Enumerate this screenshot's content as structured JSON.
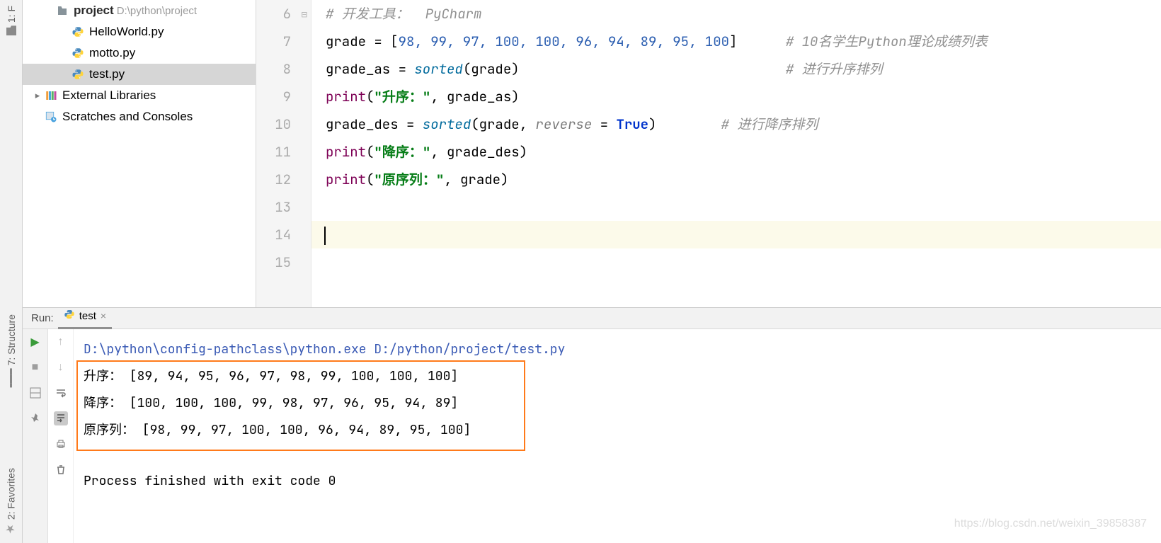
{
  "toolstrip": {
    "top_label": "1: F",
    "structure_label": "7: Structure",
    "favorites_label": "2: Favorites"
  },
  "tree": {
    "project": {
      "name": "project",
      "path": "D:\\python\\project"
    },
    "files": [
      {
        "name": "HelloWorld.py"
      },
      {
        "name": "motto.py"
      },
      {
        "name": "test.py"
      }
    ],
    "external": "External Libraries",
    "scratches": "Scratches and Consoles"
  },
  "editor": {
    "lines": {
      "l6": {
        "num": "6",
        "comment": "# 开发工具：  PyCharm"
      },
      "l7": {
        "num": "7",
        "assign": "grade = [",
        "nums": "98, 99, 97, 100, 100, 96, 94, 89, 95, 100",
        "close": "]",
        "comment": "# 10名学生Python理论成绩列表"
      },
      "l8": {
        "num": "8",
        "assign": "grade_as = ",
        "fn": "sorted",
        "args": "(grade)",
        "comment": "# 进行升序排列"
      },
      "l9": {
        "num": "9",
        "fn": "print",
        "open": "(",
        "str": "\"升序：\"",
        "rest": ", grade_as)"
      },
      "l10": {
        "num": "10",
        "assign": "grade_des = ",
        "fn": "sorted",
        "open": "(grade, ",
        "param": "reverse",
        "eq": " = ",
        "kw": "True",
        "close": ")",
        "comment": "# 进行降序排列"
      },
      "l11": {
        "num": "11",
        "fn": "print",
        "open": "(",
        "str": "\"降序：\"",
        "rest": ", grade_des)"
      },
      "l12": {
        "num": "12",
        "fn": "print",
        "open": "(",
        "str": "\"原序列：\"",
        "rest": ", grade)"
      },
      "l13": {
        "num": "13"
      },
      "l14": {
        "num": "14"
      },
      "l15": {
        "num": "15"
      }
    }
  },
  "run": {
    "label": "Run:",
    "tab": "test",
    "cmd": "D:\\python\\config-pathclass\\python.exe D:/python/project/test.py",
    "out1": "升序： [89, 94, 95, 96, 97, 98, 99, 100, 100, 100]",
    "out2": "降序： [100, 100, 100, 99, 98, 97, 96, 95, 94, 89]",
    "out3": "原序列： [98, 99, 97, 100, 100, 96, 94, 89, 95, 100]",
    "exit": "Process finished with exit code 0"
  },
  "watermark": "https://blog.csdn.net/weixin_39858387"
}
